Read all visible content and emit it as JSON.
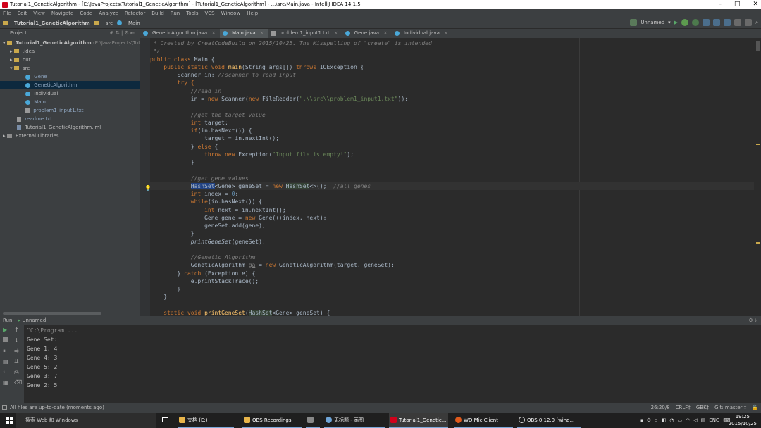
{
  "window": {
    "title": "Tutorial1_GeneticAlgorithm - [E:\\JavaProjects\\Tutorial1_GeneticAlgorithm] - [Tutorial1_GeneticAlgorithm] - ...\\src\\Main.java - IntelliJ IDEA 14.1.5",
    "minimize": "–",
    "maximize": "□",
    "close": "✕"
  },
  "menu": [
    "File",
    "Edit",
    "View",
    "Navigate",
    "Code",
    "Analyze",
    "Refactor",
    "Build",
    "Run",
    "Tools",
    "VCS",
    "Window",
    "Help"
  ],
  "navbar": {
    "project": "Tutorial1_GeneticAlgorithm",
    "src": "src",
    "file": "Main",
    "run_config": "Unnamed"
  },
  "project_panel": {
    "title": "Project"
  },
  "tree": [
    {
      "label": "Tutorial1_GeneticAlgorithm",
      "suffix": "(E:\\JavaProjects\\Tutorial1_GeneticAlgorithm)",
      "kind": "root"
    },
    {
      "label": ".idea",
      "kind": "folder"
    },
    {
      "label": "out",
      "kind": "folder"
    },
    {
      "label": "src",
      "kind": "folder"
    },
    {
      "label": "Gene",
      "kind": "class"
    },
    {
      "label": "GeneticAlgorithm",
      "kind": "class"
    },
    {
      "label": "Individual",
      "kind": "class"
    },
    {
      "label": "Main",
      "kind": "class"
    },
    {
      "label": "problem1_input1.txt",
      "kind": "file"
    },
    {
      "label": "readme.txt",
      "kind": "file"
    },
    {
      "label": "Tutorial1_GeneticAlgorithm.iml",
      "kind": "file"
    },
    {
      "label": "External Libraries",
      "kind": "lib"
    }
  ],
  "tabs": [
    "GeneticAlgorithm.java",
    "Main.java",
    "problem1_input1.txt",
    "Gene.java",
    "Individual.java"
  ],
  "code": {
    "l0": " * Created by CreatCodeBuild on 2015/10/25. The Misspelling of \"create\" is intended",
    "l1": " */",
    "l2a": "public class ",
    "l2b": "Main {",
    "l3a": "    public static void ",
    "l3b": "main",
    "l3c": "(String args[]) ",
    "l3d": "throws ",
    "l3e": "IOException {",
    "l4a": "        Scanner in; ",
    "l4b": "//scanner to read input",
    "l5": "        try {",
    "l6": "            //read in",
    "l7a": "            in = ",
    "l7b": "new ",
    "l7c": "Scanner(",
    "l7d": "new ",
    "l7e": "FileReader(",
    "l7f": "\".\\\\src\\\\problem1_input1.txt\"",
    "l7g": "));",
    "l9": "            //get the target value",
    "l10a": "            ",
    "l10b": "int ",
    "l10c": "target;",
    "l11a": "            if",
    "l11b": "(in.hasNext()) {",
    "l12": "                target = in.nextInt();",
    "l13a": "            } ",
    "l13b": "else ",
    "l13c": "{",
    "l14a": "                ",
    "l14b": "throw new ",
    "l14c": "Exception(",
    "l14d": "\"Input file is empty!\"",
    "l14e": ");",
    "l15": "            }",
    "l17": "            //get gene values",
    "l18a": "            ",
    "l18b": "HashSet",
    "l18c": "<Gene> geneSet = ",
    "l18d": "new ",
    "l18e": "HashSet",
    "l18f": "<>();  ",
    "l18g": "//all genes",
    "l19a": "            ",
    "l19b": "int ",
    "l19c": "index = ",
    "l19d": "0",
    "l19e": ";",
    "l20a": "            while",
    "l20b": "(in.hasNext()) {",
    "l21a": "                ",
    "l21b": "int ",
    "l21c": "next = in.nextInt();",
    "l22a": "                Gene gene = ",
    "l22b": "new ",
    "l22c": "Gene(++index, next);",
    "l23": "                geneSet.add(gene);",
    "l24": "            }",
    "l25a": "            ",
    "l25b": "printGeneSet",
    "l25c": "(geneSet);",
    "l27": "            //Genetic Algorithm",
    "l28a": "            GeneticAlgorithm ",
    "l28b": "ga",
    "l28c": " = ",
    "l28d": "new ",
    "l28e": "GeneticAlgorithm(target, geneSet);",
    "l29a": "        } ",
    "l29b": "catch ",
    "l29c": "(Exception e) {",
    "l30": "            e.printStackTrace();",
    "l31": "        }",
    "l32": "    }",
    "l34a": "    static void ",
    "l34b": "printGeneSet",
    "l34c": "(",
    "l34d": "HashSet",
    "l34e": "<Gene> geneSet) {"
  },
  "run": {
    "header": "Run",
    "config": "Unnamed",
    "output": [
      "\"C:\\Program ...",
      "Gene Set:",
      "Gene 1: 4",
      "Gene 4: 3",
      "Gene 5: 2",
      "Gene 3: 7",
      "Gene 2: 5"
    ]
  },
  "status": {
    "message": "All files are up-to-date (moments ago)",
    "position": "26:20/8",
    "line_sep": "CRLF‡",
    "encoding": "GBK‡",
    "git": "Git: master ‡"
  },
  "taskbar": {
    "search": "搜索 Web 和 Windows",
    "items": [
      "文档 (E:)",
      "OBS Recordings",
      "",
      "无标题 - 画图",
      "Tutorial1_Genetic...",
      "WO Mic Client",
      "OBS 0.12.0 (wind..."
    ],
    "lang": "ENG",
    "time": "19:25",
    "date": "2015/10/25"
  },
  "colors": {
    "keyword": "#cc7832",
    "string": "#6a8759",
    "comment": "#808080",
    "method": "#ffc66d"
  }
}
